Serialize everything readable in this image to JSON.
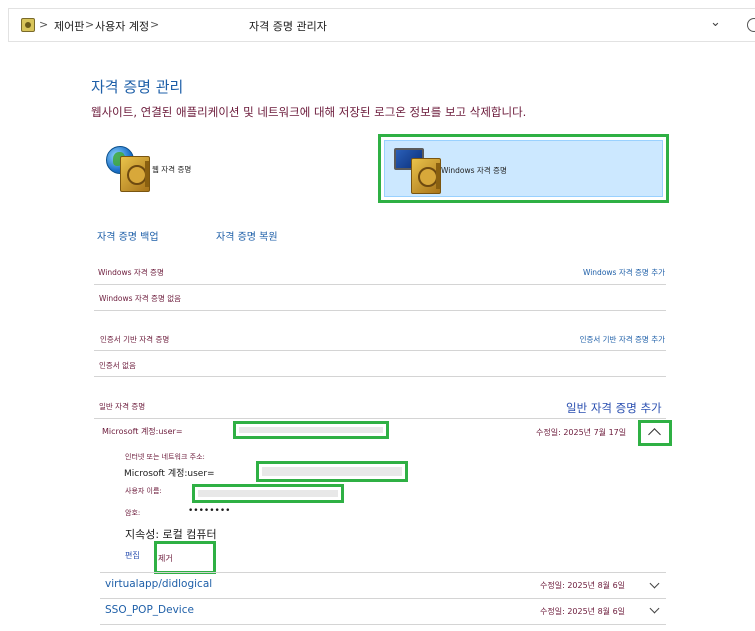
{
  "address_bar": {
    "breadcrumb": [
      "제어판",
      "사용자 계정",
      "자격 증명 관리자"
    ],
    "separator": ">"
  },
  "page": {
    "title": "자격 증명 관리",
    "subtitle": "웹사이트, 연결된 애플리케이션 및 네트워크에 대해 저장된 로그온 정보를 보고 삭제합니다."
  },
  "tiles": {
    "web": "웹 자격 증명",
    "windows": "Windows 자격 증명"
  },
  "actions": {
    "backup": "자격 증명 백업",
    "restore": "자격 증명 복원"
  },
  "sections": {
    "windows": {
      "title": "Windows 자격 증명",
      "add": "Windows 자격 증명 추가",
      "empty": "Windows 자격 증명 없음"
    },
    "certificate": {
      "title": "인증서 기반 자격 증명",
      "add": "인증서 기반 자격 증명 추가",
      "empty": "인증서 없음"
    },
    "generic": {
      "title": "일반 자격 증명",
      "add": "일반 자격 증명 추가"
    }
  },
  "expanded_credential": {
    "name": "Microsoft 계정:user=",
    "modified": "수정일: 2025년 7월 17일",
    "address_label": "인터넷 또는 네트워크 주소:",
    "address_value": "Microsoft 계정:user=",
    "username_label": "사용자 이름:",
    "password_label": "암호:",
    "password_value": "••••••••",
    "persistence": "지속성: 로컬 컴퓨터",
    "edit": "편집",
    "remove": "제거"
  },
  "credentials": [
    {
      "name": "virtualapp/didlogical",
      "modified": "수정일: 2025년 8월 6일"
    },
    {
      "name": "SSO_POP_Device",
      "modified": "수정일: 2025년 8월 6일"
    }
  ],
  "colors": {
    "highlight": "#2fb044",
    "link": "#1e5fa8",
    "label": "#6b1a3a",
    "selected_tile": "#cce8ff"
  }
}
